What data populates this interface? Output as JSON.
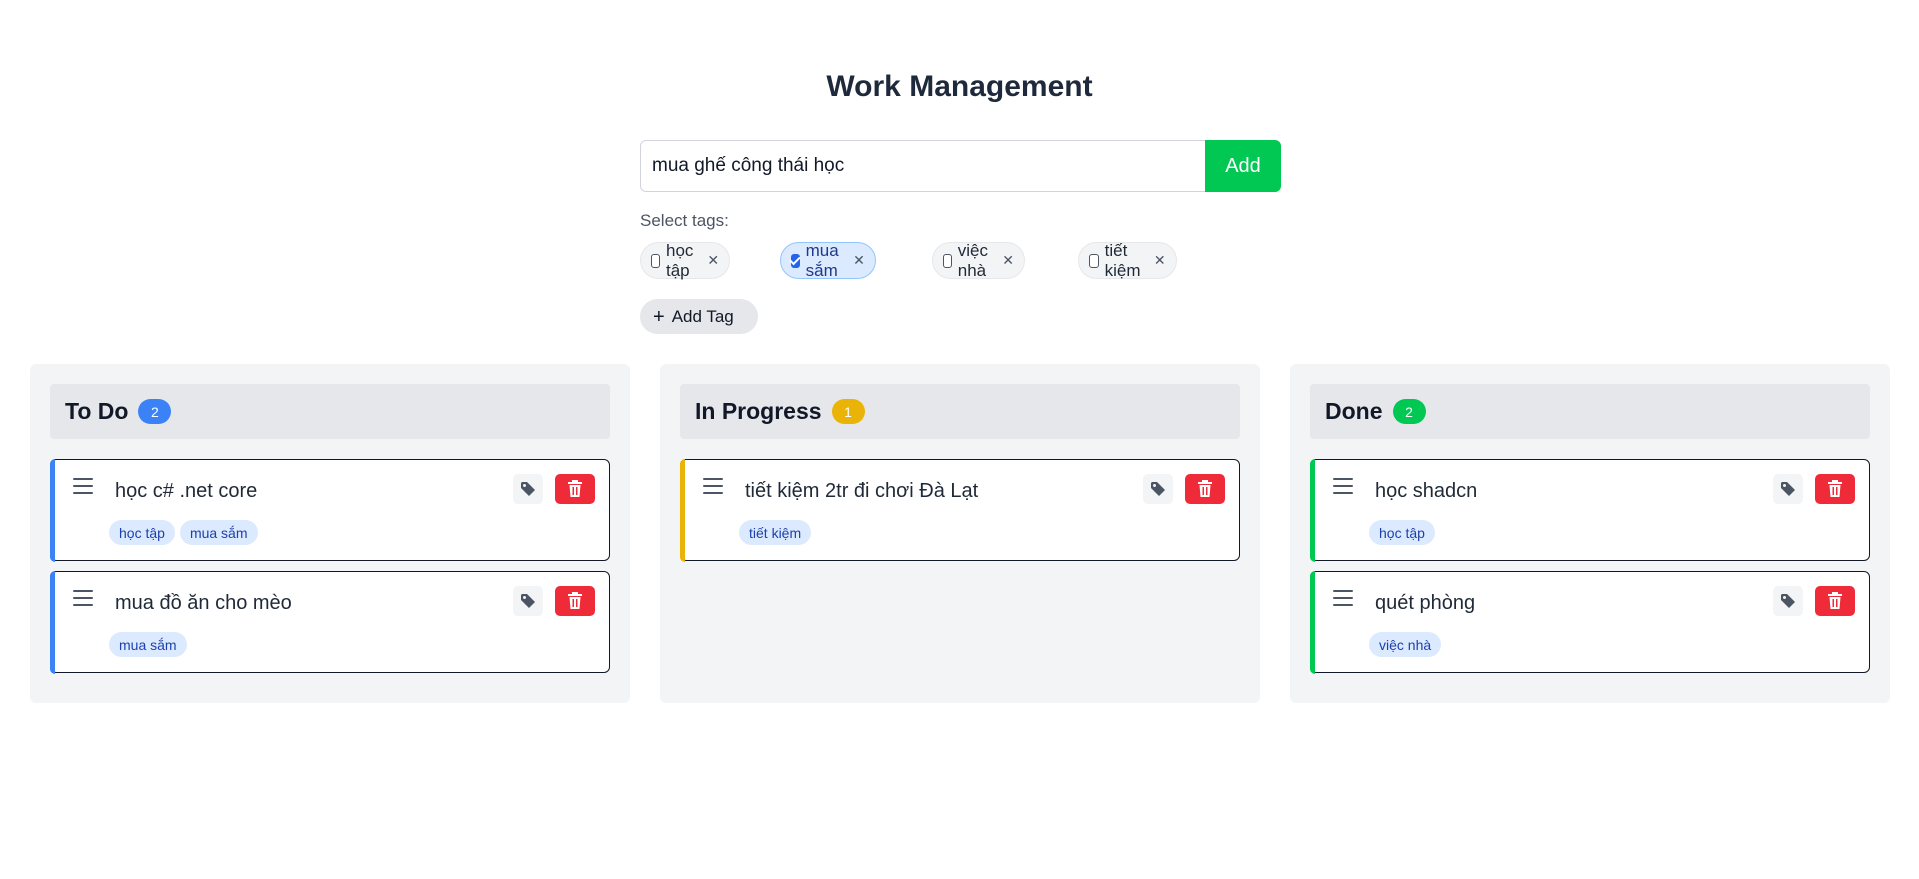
{
  "colors": {
    "todo": "#3b82f6",
    "in_progress": "#eab308",
    "done": "#00c853",
    "add_button": "#00c853",
    "delete_button": "#ef2b39"
  },
  "page": {
    "title": "Work Management"
  },
  "form": {
    "input_value": "mua ghế công thái học",
    "add_label": "Add",
    "select_tags_label": "Select tags:",
    "add_tag_label": "Add Tag"
  },
  "tag_options": [
    {
      "label": "học tập",
      "selected": false
    },
    {
      "label": "mua sắm",
      "selected": true
    },
    {
      "label": "việc nhà",
      "selected": false
    },
    {
      "label": "tiết kiệm",
      "selected": false
    }
  ],
  "columns": [
    {
      "title": "To Do",
      "count": "2",
      "color": "#3b82f6",
      "cards": [
        {
          "title": "học c# .net core",
          "tags": [
            "học tập",
            "mua sắm"
          ]
        },
        {
          "title": "mua đồ ăn cho mèo",
          "tags": [
            "mua sắm"
          ]
        }
      ]
    },
    {
      "title": "In Progress",
      "count": "1",
      "color": "#eab308",
      "cards": [
        {
          "title": "tiết kiệm 2tr đi chơi Đà Lạt",
          "tags": [
            "tiết kiệm"
          ]
        }
      ]
    },
    {
      "title": "Done",
      "count": "2",
      "color": "#00c853",
      "cards": [
        {
          "title": "học shadcn",
          "tags": [
            "học tập"
          ]
        },
        {
          "title": "quét phòng",
          "tags": [
            "việc nhà"
          ]
        }
      ]
    }
  ]
}
